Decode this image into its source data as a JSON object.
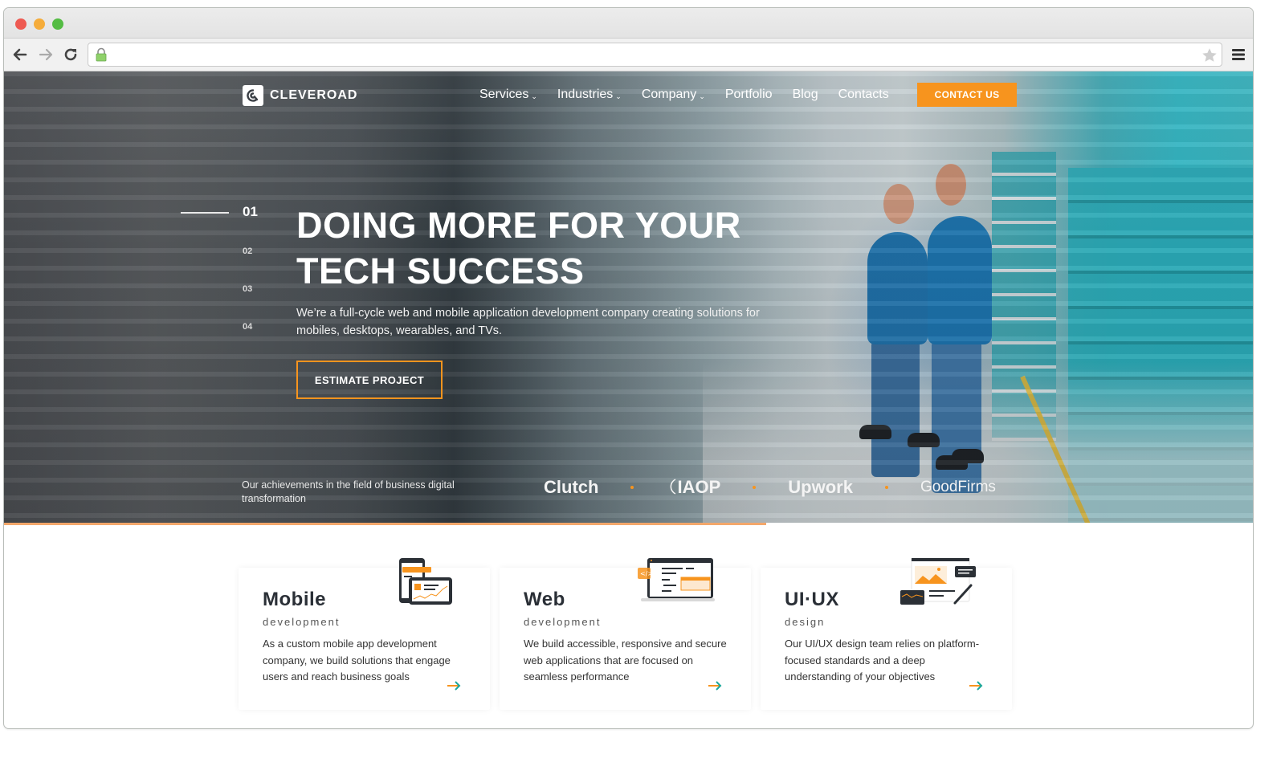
{
  "browser": {
    "url": "",
    "secure": true
  },
  "header": {
    "brand": "CLEVEROAD",
    "nav": [
      {
        "label": "Services",
        "dropdown": true
      },
      {
        "label": "Industries",
        "dropdown": true
      },
      {
        "label": "Company",
        "dropdown": true
      },
      {
        "label": "Portfolio",
        "dropdown": false
      },
      {
        "label": "Blog",
        "dropdown": false
      },
      {
        "label": "Contacts",
        "dropdown": false
      }
    ],
    "cta_label": "CONTACT US",
    "accent_color": "#f7941e"
  },
  "hero": {
    "slides": [
      "01",
      "02",
      "03",
      "04"
    ],
    "active_slide": "01",
    "title_line1": "DOING MORE FOR YOUR",
    "title_line2": "TECH SUCCESS",
    "subtitle": "We’re a full-cycle web and mobile application development company creating solutions for mobiles, desktops, wearables, and TVs.",
    "cta_label": "ESTIMATE PROJECT",
    "achievements_text": "Our achievements in the field of business digital transformation",
    "awards": [
      "Clutch",
      "IAOP",
      "Upwork",
      "GoodFirms"
    ],
    "slide_progress": 0.61
  },
  "services": [
    {
      "title": "Mobile",
      "subtitle": "development",
      "description": "As a custom mobile app development company, we build solutions that engage users and reach business goals",
      "icon": "mobile-illustration"
    },
    {
      "title": "Web",
      "subtitle": "development",
      "description": "We build accessible, responsive and secure web applications that are focused on seamless performance",
      "icon": "web-illustration"
    },
    {
      "title": "UI·UX",
      "subtitle": "design",
      "description": "Our UI/UX design team relies on platform-focused standards and a deep understanding of your objectives",
      "icon": "uiux-illustration"
    }
  ]
}
